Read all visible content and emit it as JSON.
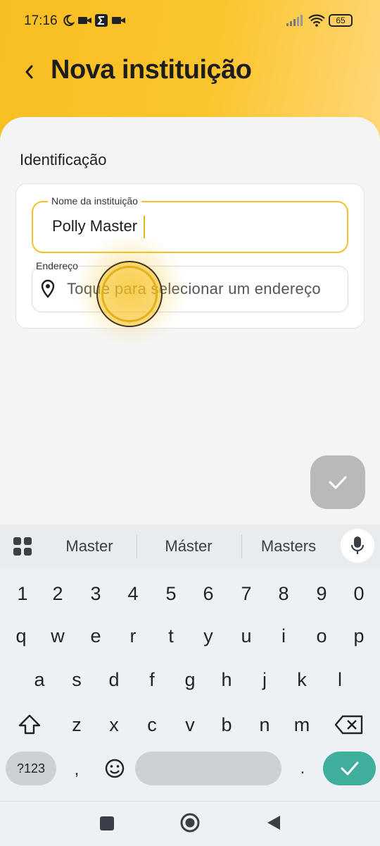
{
  "status_bar": {
    "time": "17:16",
    "battery": "65"
  },
  "header": {
    "title": "Nova instituição"
  },
  "section": {
    "title": "Identificação"
  },
  "form": {
    "name_label": "Nome da instituição",
    "name_value": "Polly Master",
    "address_label": "Endereço",
    "address_placeholder": "Toque para selecionar um endereço"
  },
  "colors": {
    "accent": "#f3c02b",
    "header_start": "#f8bf23",
    "header_end": "#fed77a",
    "fab_disabled": "#b9b9b9",
    "enter_key": "#3fae9c"
  },
  "keyboard": {
    "suggestions": [
      "Master",
      "Máster",
      "Masters"
    ],
    "row_numbers": [
      "1",
      "2",
      "3",
      "4",
      "5",
      "6",
      "7",
      "8",
      "9",
      "0"
    ],
    "row_1": [
      "q",
      "w",
      "e",
      "r",
      "t",
      "y",
      "u",
      "i",
      "o",
      "p"
    ],
    "row_2": [
      "a",
      "s",
      "d",
      "f",
      "g",
      "h",
      "j",
      "k",
      "l"
    ],
    "row_3": [
      "z",
      "x",
      "c",
      "v",
      "b",
      "n",
      "m"
    ],
    "symbols_label": "?123",
    "comma": ",",
    "period": "."
  }
}
